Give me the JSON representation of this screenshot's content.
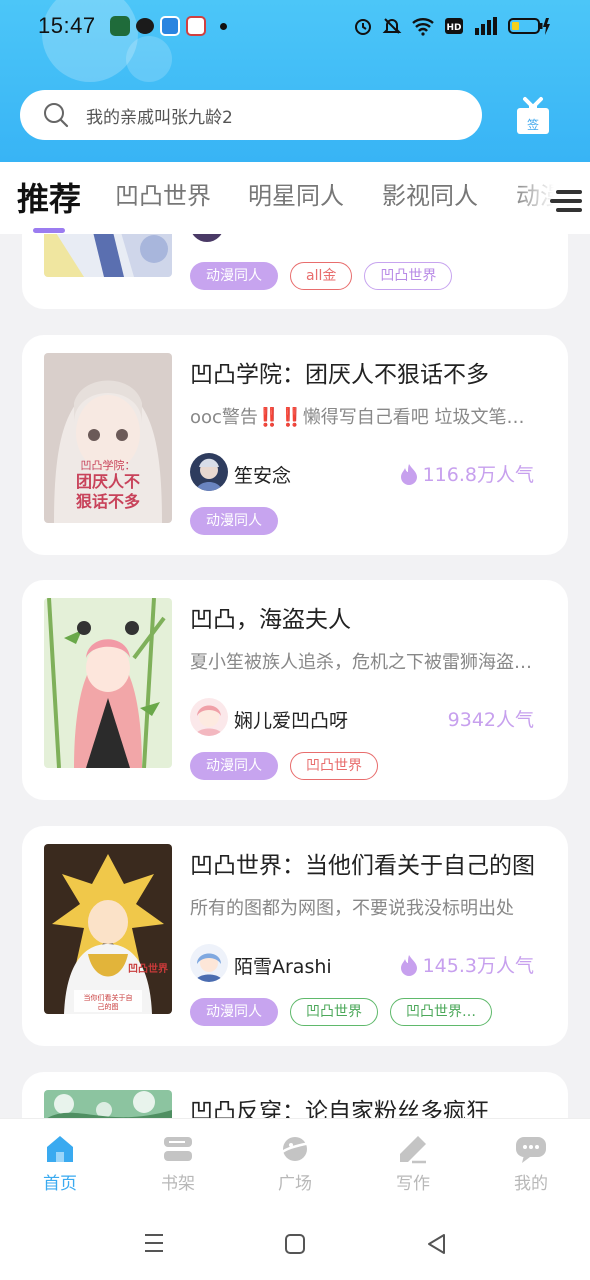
{
  "status_bar": {
    "time": "15:47"
  },
  "search": {
    "placeholder": "我的亲戚叫张九龄2"
  },
  "signin": {
    "label": "签"
  },
  "tabs": [
    {
      "label": "推荐",
      "active": true
    },
    {
      "label": "凹凸世界"
    },
    {
      "label": "明星同人"
    },
    {
      "label": "影视同人"
    },
    {
      "label": "动漫"
    }
  ],
  "cards": [
    {
      "title": "",
      "tags": [
        {
          "label": "动漫同人",
          "style": "filled"
        },
        {
          "label": "all金",
          "style": "red"
        },
        {
          "label": "凹凸世界",
          "style": "purple"
        }
      ]
    },
    {
      "title": "凹凸学院：团厌人不狠话不多",
      "desc": "ooc警告‼️‼️懒得写自己看吧 垃圾文笔…",
      "author": "笙安念",
      "popularity": "116.8万人气",
      "show_flame": true,
      "cover_text": [
        "凹凸学院：",
        "团厌人不",
        "狠话不多"
      ],
      "tags": [
        {
          "label": "动漫同人",
          "style": "filled"
        }
      ]
    },
    {
      "title": "凹凸，海盗夫人",
      "desc": "夏小笙被族人追杀，危机之下被雷狮海盗…",
      "author": "娴儿爱凹凸呀",
      "popularity": "9342人气",
      "show_flame": false,
      "tags": [
        {
          "label": "动漫同人",
          "style": "filled"
        },
        {
          "label": "凹凸世界",
          "style": "red"
        }
      ]
    },
    {
      "title": "凹凸世界：当他们看关于自己的图",
      "desc": "所有的图都为网图，不要说我没标明出处",
      "author": "陌雪Arashi",
      "popularity": "145.3万人气",
      "show_flame": true,
      "cover_text": [
        "凹凸世界",
        "当你们看关于自",
        "己的图"
      ],
      "tags": [
        {
          "label": "动漫同人",
          "style": "filled"
        },
        {
          "label": "凹凸世界",
          "style": "green"
        },
        {
          "label": "凹凸世界…",
          "style": "green"
        }
      ]
    },
    {
      "title": "凹凸反穿：论自家粉丝多疯狂"
    }
  ],
  "bottom_nav": [
    {
      "label": "首页",
      "icon": "home-icon",
      "active": true
    },
    {
      "label": "书架",
      "icon": "bookshelf-icon"
    },
    {
      "label": "广场",
      "icon": "planet-icon"
    },
    {
      "label": "写作",
      "icon": "pen-icon"
    },
    {
      "label": "我的",
      "icon": "chat-bubble-icon"
    }
  ],
  "colors": {
    "header": "#3fbaf6",
    "accent_purple": "#c7a4ef",
    "nav_active": "#3aaaf0"
  }
}
